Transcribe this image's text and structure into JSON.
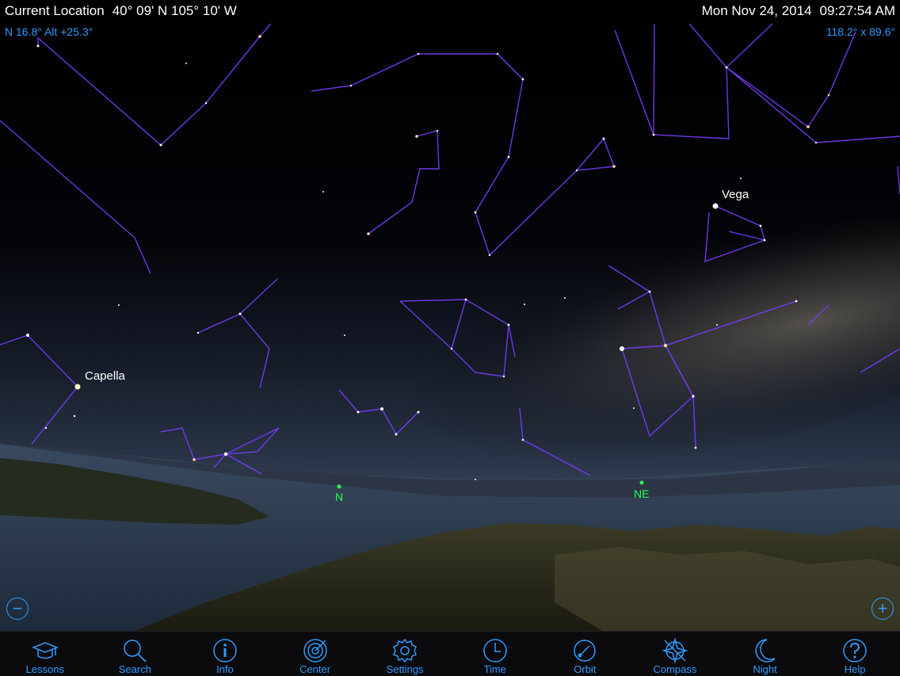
{
  "status_bar": {
    "location_label": "Current Location",
    "coordinates": "40° 09' N 105° 10' W",
    "date": "Mon Nov 24, 2014",
    "time": "09:27:54 AM"
  },
  "view": {
    "orientation_readout": "N 16.8° Alt +25.3°",
    "field_of_view_readout": "118.2° x 89.6°"
  },
  "sky_labels": {
    "vega": "Vega",
    "capella": "Capella"
  },
  "horizon_markers": {
    "north": "N",
    "northeast": "NE"
  },
  "zoom": {
    "zoom_out_symbol": "−",
    "zoom_in_symbol": "+"
  },
  "toolbar": {
    "items": [
      {
        "label": "Lessons",
        "icon": "graduation-cap-icon"
      },
      {
        "label": "Search",
        "icon": "magnifier-icon"
      },
      {
        "label": "Info",
        "icon": "info-icon"
      },
      {
        "label": "Center",
        "icon": "target-icon"
      },
      {
        "label": "Settings",
        "icon": "gear-icon"
      },
      {
        "label": "Time",
        "icon": "clock-icon"
      },
      {
        "label": "Orbit",
        "icon": "orbit-icon"
      },
      {
        "label": "Compass",
        "icon": "compass-icon"
      },
      {
        "label": "Night",
        "icon": "moon-icon"
      },
      {
        "label": "Help",
        "icon": "question-icon"
      }
    ],
    "accent_color": "#2f9bff"
  },
  "colors": {
    "constellation_lines": "#7a3cff",
    "direction_markers": "#22ff55",
    "readouts": "#2f9bff"
  }
}
